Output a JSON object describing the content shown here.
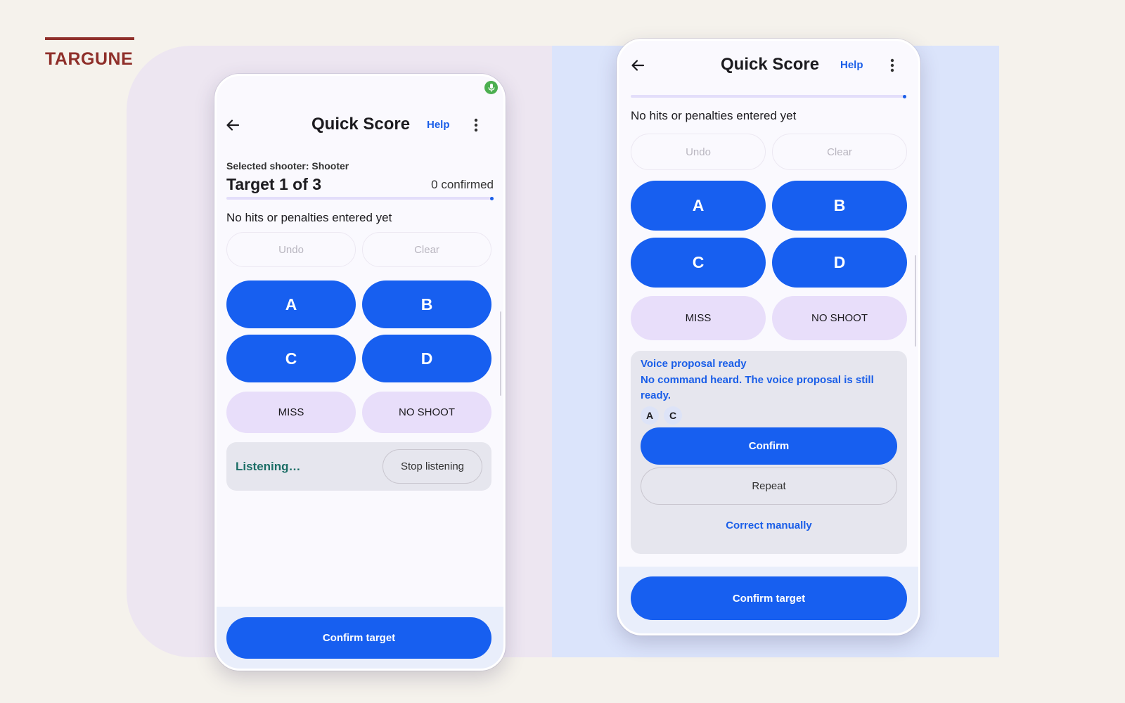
{
  "brand": {
    "name": "TARGUNE"
  },
  "colors": {
    "accent": "#175ff0",
    "brand": "#8f2f2a",
    "listening": "#1c6e66",
    "mic": "#4caf50"
  },
  "screen_listening": {
    "header": {
      "back_icon": "arrow-left-icon",
      "title": "Quick Score",
      "help_label": "Help",
      "menu_icon": "more-vert-icon"
    },
    "mic_indicator": "mic-icon",
    "selected_shooter": "Selected shooter: Shooter",
    "target_label": "Target 1 of 3",
    "confirmed_label": "0 confirmed",
    "status": "No hits or penalties entered yet",
    "undo_label": "Undo",
    "clear_label": "Clear",
    "scores": [
      "A",
      "B",
      "C",
      "D"
    ],
    "miss_label": "MISS",
    "no_shoot_label": "NO SHOOT",
    "listening_label": "Listening…",
    "stop_listening_label": "Stop listening",
    "confirm_target_label": "Confirm target"
  },
  "screen_proposal": {
    "header": {
      "back_icon": "arrow-left-icon",
      "title": "Quick Score",
      "help_label": "Help",
      "menu_icon": "more-vert-icon"
    },
    "status": "No hits or penalties entered yet",
    "undo_label": "Undo",
    "clear_label": "Clear",
    "scores": [
      "A",
      "B",
      "C",
      "D"
    ],
    "miss_label": "MISS",
    "no_shoot_label": "NO SHOOT",
    "voice": {
      "title": "Voice proposal ready",
      "message": "No command heard. The voice proposal is still ready.",
      "chips": [
        "A",
        "C"
      ],
      "confirm_label": "Confirm",
      "repeat_label": "Repeat",
      "correct_label": "Correct manually"
    },
    "confirm_target_label": "Confirm target"
  }
}
